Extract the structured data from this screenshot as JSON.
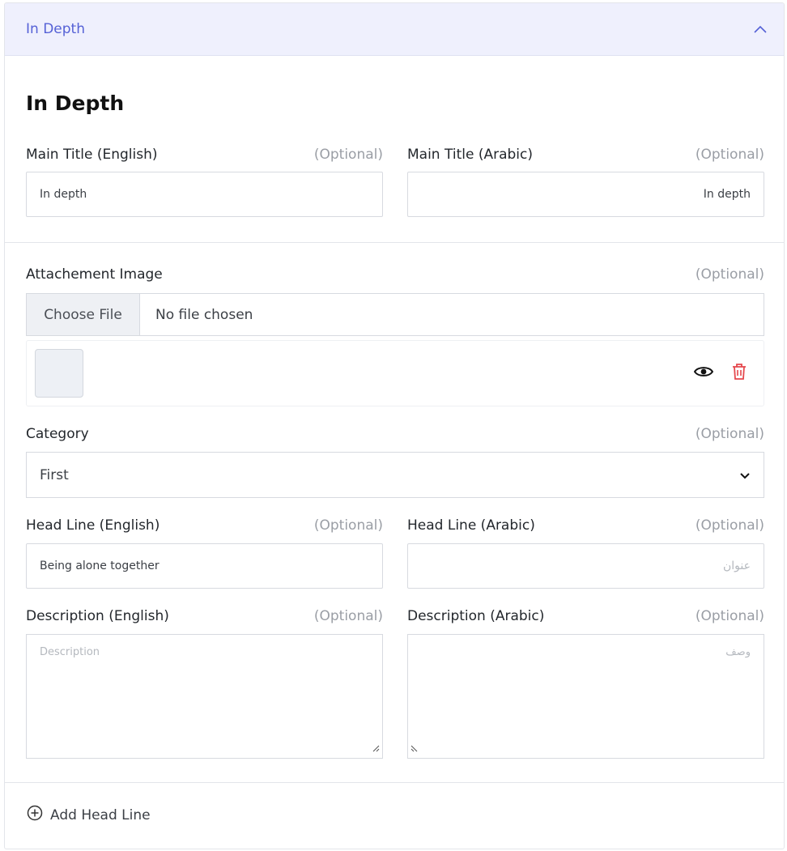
{
  "accordion": {
    "title": "In Depth"
  },
  "section": {
    "title": "In Depth"
  },
  "main_title_en": {
    "label": "Main Title (English)",
    "optional": "(Optional)",
    "value": "In depth"
  },
  "main_title_ar": {
    "label": "Main Title (Arabic)",
    "optional": "(Optional)",
    "value": "In depth"
  },
  "attachment": {
    "label": "Attachement Image",
    "optional": "(Optional)",
    "button": "Choose File",
    "status": "No file chosen"
  },
  "category": {
    "label": "Category",
    "optional": "(Optional)",
    "selected": "First"
  },
  "headline_en": {
    "label": "Head Line (English)",
    "optional": "(Optional)",
    "value": "Being alone together"
  },
  "headline_ar": {
    "label": "Head Line (Arabic)",
    "optional": "(Optional)",
    "placeholder": "عنوان"
  },
  "desc_en": {
    "label": "Description (English)",
    "optional": "(Optional)",
    "placeholder": "Description"
  },
  "desc_ar": {
    "label": "Description (Arabic)",
    "optional": "(Optional)",
    "placeholder": "وصف"
  },
  "add_headline": {
    "label": "Add Head Line"
  },
  "colors": {
    "accent": "#5561d6",
    "header_bg": "#eff0fd",
    "delete": "#e5484d"
  },
  "icons": [
    "chevron-up-icon",
    "eye-icon",
    "trash-icon",
    "chevron-down-icon",
    "plus-circle-icon",
    "resize-handle-icon"
  ]
}
